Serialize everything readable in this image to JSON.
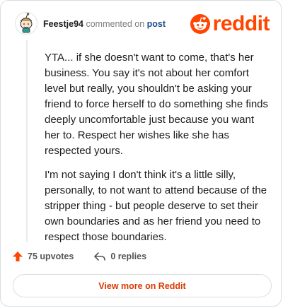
{
  "header": {
    "username": "Feestje94",
    "commented_on": "commented on",
    "post_link": "post",
    "brand": "reddit",
    "brand_color": "#ff4500"
  },
  "comment": {
    "paragraphs": [
      "YTA... if she doesn't want to come, that's her business. You say it's not about her comfort level but really, you shouldn't be asking your friend to force herself to do something she finds deeply uncomfortable just because you want her to. Respect her wishes like she has respected yours.",
      "I'm not saying I don't think it's a little silly, personally, to not want to attend because of the stripper thing - but people deserve to set their own boundaries and as her friend you need to respect those boundaries."
    ]
  },
  "actions": {
    "upvotes": "75 upvotes",
    "replies": "0 replies",
    "upvote_icon": "upvote-arrow-icon",
    "reply_icon": "reply-arrow-icon"
  },
  "footer": {
    "view_more": "View more on Reddit"
  }
}
